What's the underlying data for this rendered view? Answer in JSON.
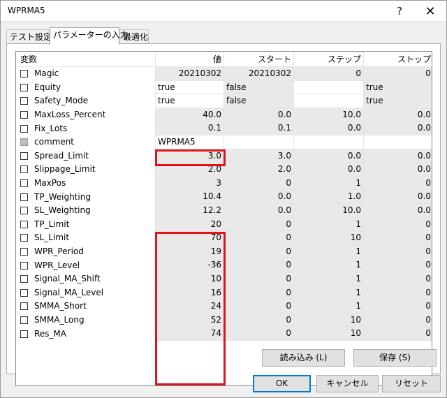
{
  "window": {
    "title": "WPRMA5",
    "help_glyph": "?",
    "close_glyph": "✕"
  },
  "tabs": [
    {
      "label": "テスト設定"
    },
    {
      "label": "パラメーターの入力",
      "active": true
    },
    {
      "label": "最適化"
    }
  ],
  "grid": {
    "headers": [
      "変数",
      "値",
      "スタート",
      "ステップ",
      "ストップ"
    ],
    "rows": [
      {
        "name": "Magic",
        "value": "20210302",
        "start": "20210302",
        "step": "0",
        "stop": "0"
      },
      {
        "name": "Equity",
        "value": "true",
        "start": "false",
        "step": "",
        "stop": "true"
      },
      {
        "name": "Safety_Mode",
        "value": "true",
        "start": "false",
        "step": "",
        "stop": "true"
      },
      {
        "name": "MaxLoss_Percent",
        "value": "40.0",
        "start": "0.0",
        "step": "10.0",
        "stop": "0.0"
      },
      {
        "name": "Fix_Lots",
        "value": "0.1",
        "start": "0.1",
        "step": "0.0",
        "stop": "0.0"
      },
      {
        "name": "comment",
        "value": "WPRMA5",
        "start": "",
        "step": "",
        "stop": "",
        "disabled": true
      },
      {
        "name": "Spread_Limit",
        "value": "3.0",
        "start": "3.0",
        "step": "0.0",
        "stop": "0.0"
      },
      {
        "name": "Slippage_Limit",
        "value": "2.0",
        "start": "2.0",
        "step": "0.0",
        "stop": "0.0"
      },
      {
        "name": "MaxPos",
        "value": "3",
        "start": "0",
        "step": "1",
        "stop": "0"
      },
      {
        "name": "TP_Weighting",
        "value": "10.4",
        "start": "0.0",
        "step": "1.0",
        "stop": "0.0"
      },
      {
        "name": "SL_Weighting",
        "value": "12.2",
        "start": "0.0",
        "step": "10.0",
        "stop": "0.0"
      },
      {
        "name": "TP_Limit",
        "value": "20",
        "start": "0",
        "step": "1",
        "stop": "0"
      },
      {
        "name": "SL_Limit",
        "value": "70",
        "start": "0",
        "step": "10",
        "stop": "0"
      },
      {
        "name": "WPR_Period",
        "value": "19",
        "start": "0",
        "step": "1",
        "stop": "0"
      },
      {
        "name": "WPR_Level",
        "value": "-36",
        "start": "0",
        "step": "1",
        "stop": "0"
      },
      {
        "name": "Signal_MA_Shift",
        "value": "10",
        "start": "0",
        "step": "1",
        "stop": "0"
      },
      {
        "name": "Signal_MA_Level",
        "value": "16",
        "start": "0",
        "step": "1",
        "stop": "0"
      },
      {
        "name": "SMMA_Short",
        "value": "24",
        "start": "0",
        "step": "1",
        "stop": "0"
      },
      {
        "name": "SMMA_Long",
        "value": "52",
        "start": "0",
        "step": "10",
        "stop": "0"
      },
      {
        "name": "Res_MA",
        "value": "74",
        "start": "0",
        "step": "10",
        "stop": "0"
      }
    ]
  },
  "buttons": {
    "load": "読み込み (L)",
    "save": "保存 (S)",
    "ok": "OK",
    "cancel": "キャンセル",
    "reset": "リセット"
  },
  "colors": {
    "highlight": "#e0141e",
    "grey_cell": "#e9e9e9",
    "default_button_border": "#0078d7"
  }
}
